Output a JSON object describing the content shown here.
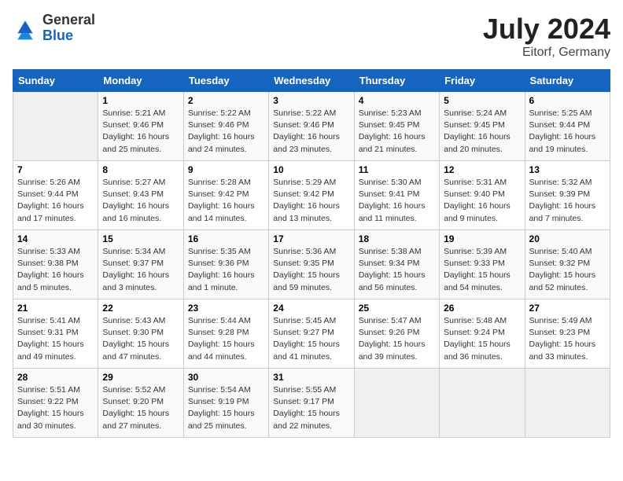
{
  "header": {
    "logo": {
      "line1": "General",
      "line2": "Blue"
    },
    "title": "July 2024",
    "location": "Eitorf, Germany"
  },
  "weekdays": [
    "Sunday",
    "Monday",
    "Tuesday",
    "Wednesday",
    "Thursday",
    "Friday",
    "Saturday"
  ],
  "weeks": [
    [
      {
        "day": "",
        "empty": true
      },
      {
        "day": "1",
        "sunrise": "5:21 AM",
        "sunset": "9:46 PM",
        "daylight": "16 hours and 25 minutes."
      },
      {
        "day": "2",
        "sunrise": "5:22 AM",
        "sunset": "9:46 PM",
        "daylight": "16 hours and 24 minutes."
      },
      {
        "day": "3",
        "sunrise": "5:22 AM",
        "sunset": "9:46 PM",
        "daylight": "16 hours and 23 minutes."
      },
      {
        "day": "4",
        "sunrise": "5:23 AM",
        "sunset": "9:45 PM",
        "daylight": "16 hours and 21 minutes."
      },
      {
        "day": "5",
        "sunrise": "5:24 AM",
        "sunset": "9:45 PM",
        "daylight": "16 hours and 20 minutes."
      },
      {
        "day": "6",
        "sunrise": "5:25 AM",
        "sunset": "9:44 PM",
        "daylight": "16 hours and 19 minutes."
      }
    ],
    [
      {
        "day": "7",
        "sunrise": "5:26 AM",
        "sunset": "9:44 PM",
        "daylight": "16 hours and 17 minutes."
      },
      {
        "day": "8",
        "sunrise": "5:27 AM",
        "sunset": "9:43 PM",
        "daylight": "16 hours and 16 minutes."
      },
      {
        "day": "9",
        "sunrise": "5:28 AM",
        "sunset": "9:42 PM",
        "daylight": "16 hours and 14 minutes."
      },
      {
        "day": "10",
        "sunrise": "5:29 AM",
        "sunset": "9:42 PM",
        "daylight": "16 hours and 13 minutes."
      },
      {
        "day": "11",
        "sunrise": "5:30 AM",
        "sunset": "9:41 PM",
        "daylight": "16 hours and 11 minutes."
      },
      {
        "day": "12",
        "sunrise": "5:31 AM",
        "sunset": "9:40 PM",
        "daylight": "16 hours and 9 minutes."
      },
      {
        "day": "13",
        "sunrise": "5:32 AM",
        "sunset": "9:39 PM",
        "daylight": "16 hours and 7 minutes."
      }
    ],
    [
      {
        "day": "14",
        "sunrise": "5:33 AM",
        "sunset": "9:38 PM",
        "daylight": "16 hours and 5 minutes."
      },
      {
        "day": "15",
        "sunrise": "5:34 AM",
        "sunset": "9:37 PM",
        "daylight": "16 hours and 3 minutes."
      },
      {
        "day": "16",
        "sunrise": "5:35 AM",
        "sunset": "9:36 PM",
        "daylight": "16 hours and 1 minute."
      },
      {
        "day": "17",
        "sunrise": "5:36 AM",
        "sunset": "9:35 PM",
        "daylight": "15 hours and 59 minutes."
      },
      {
        "day": "18",
        "sunrise": "5:38 AM",
        "sunset": "9:34 PM",
        "daylight": "15 hours and 56 minutes."
      },
      {
        "day": "19",
        "sunrise": "5:39 AM",
        "sunset": "9:33 PM",
        "daylight": "15 hours and 54 minutes."
      },
      {
        "day": "20",
        "sunrise": "5:40 AM",
        "sunset": "9:32 PM",
        "daylight": "15 hours and 52 minutes."
      }
    ],
    [
      {
        "day": "21",
        "sunrise": "5:41 AM",
        "sunset": "9:31 PM",
        "daylight": "15 hours and 49 minutes."
      },
      {
        "day": "22",
        "sunrise": "5:43 AM",
        "sunset": "9:30 PM",
        "daylight": "15 hours and 47 minutes."
      },
      {
        "day": "23",
        "sunrise": "5:44 AM",
        "sunset": "9:28 PM",
        "daylight": "15 hours and 44 minutes."
      },
      {
        "day": "24",
        "sunrise": "5:45 AM",
        "sunset": "9:27 PM",
        "daylight": "15 hours and 41 minutes."
      },
      {
        "day": "25",
        "sunrise": "5:47 AM",
        "sunset": "9:26 PM",
        "daylight": "15 hours and 39 minutes."
      },
      {
        "day": "26",
        "sunrise": "5:48 AM",
        "sunset": "9:24 PM",
        "daylight": "15 hours and 36 minutes."
      },
      {
        "day": "27",
        "sunrise": "5:49 AM",
        "sunset": "9:23 PM",
        "daylight": "15 hours and 33 minutes."
      }
    ],
    [
      {
        "day": "28",
        "sunrise": "5:51 AM",
        "sunset": "9:22 PM",
        "daylight": "15 hours and 30 minutes."
      },
      {
        "day": "29",
        "sunrise": "5:52 AM",
        "sunset": "9:20 PM",
        "daylight": "15 hours and 27 minutes."
      },
      {
        "day": "30",
        "sunrise": "5:54 AM",
        "sunset": "9:19 PM",
        "daylight": "15 hours and 25 minutes."
      },
      {
        "day": "31",
        "sunrise": "5:55 AM",
        "sunset": "9:17 PM",
        "daylight": "15 hours and 22 minutes."
      },
      {
        "day": "",
        "empty": true
      },
      {
        "day": "",
        "empty": true
      },
      {
        "day": "",
        "empty": true
      }
    ]
  ]
}
